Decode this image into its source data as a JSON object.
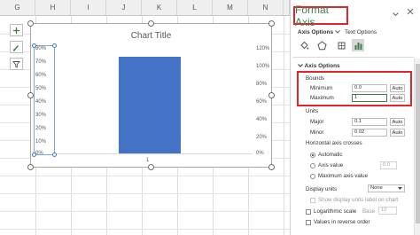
{
  "sheet": {
    "columns": [
      "G",
      "H",
      "I",
      "J",
      "K",
      "L",
      "M",
      "N",
      "O"
    ]
  },
  "chart_tools": [
    "add-chart-element",
    "chart-styles",
    "chart-filters"
  ],
  "chart": {
    "title": "Chart Title",
    "category": "1",
    "left_ticks": [
      "80%",
      "70%",
      "60%",
      "50%",
      "40%",
      "30%",
      "20%",
      "10%",
      "0%"
    ],
    "right_ticks": [
      "120%",
      "100%",
      "80%",
      "60%",
      "40%",
      "20%",
      "0%"
    ],
    "colors": {
      "blue": "#4472c4",
      "orange": "#ed7d31"
    }
  },
  "chart_data": {
    "type": "bar",
    "title": "Chart Title",
    "categories": [
      "1"
    ],
    "primary_axis": {
      "ticks": [
        "0%",
        "10%",
        "20%",
        "30%",
        "40%",
        "50%",
        "60%",
        "70%",
        "80%"
      ],
      "ylim": [
        0,
        0.8
      ]
    },
    "secondary_axis": {
      "ticks": [
        "0%",
        "20%",
        "40%",
        "60%",
        "80%",
        "100%",
        "120%"
      ],
      "ylim": [
        0,
        1.2
      ]
    },
    "series": [
      {
        "values": [
          0.73
        ],
        "axis": "primary",
        "color": "#4472c4"
      },
      {
        "values": [
          1.0
        ],
        "axis": "secondary",
        "color": "#ed7d31"
      }
    ]
  },
  "pane": {
    "title": "Format Axis",
    "tabs": {
      "axis_options": "Axis Options",
      "text_options": "Text Options"
    },
    "icons": [
      "fill-line-icon",
      "effects-icon",
      "size-properties-icon",
      "axis-options-icon"
    ],
    "section": "Axis Options",
    "bounds": {
      "heading": "Bounds",
      "minimum_label": "Minimum",
      "minimum_value": "0.0",
      "maximum_label": "Maximum",
      "maximum_value": "1",
      "auto": "Auto"
    },
    "units": {
      "heading": "Units",
      "major_label": "Major",
      "major_value": "0.1",
      "minor_label": "Minor",
      "minor_value": "0.02",
      "auto": "Auto"
    },
    "crosses": {
      "heading": "Horizontal axis crosses",
      "automatic": "Automatic",
      "axis_value": "Axis value",
      "axis_value_input": "0.0",
      "maximum_axis_value": "Maximum axis value"
    },
    "display_units": {
      "label": "Display units",
      "value": "None"
    },
    "show_label": "Show display units label on chart",
    "log_scale": {
      "label": "Logarithmic scale",
      "base_label": "Base",
      "base_value": "10"
    },
    "reverse": "Values in reverse order"
  }
}
